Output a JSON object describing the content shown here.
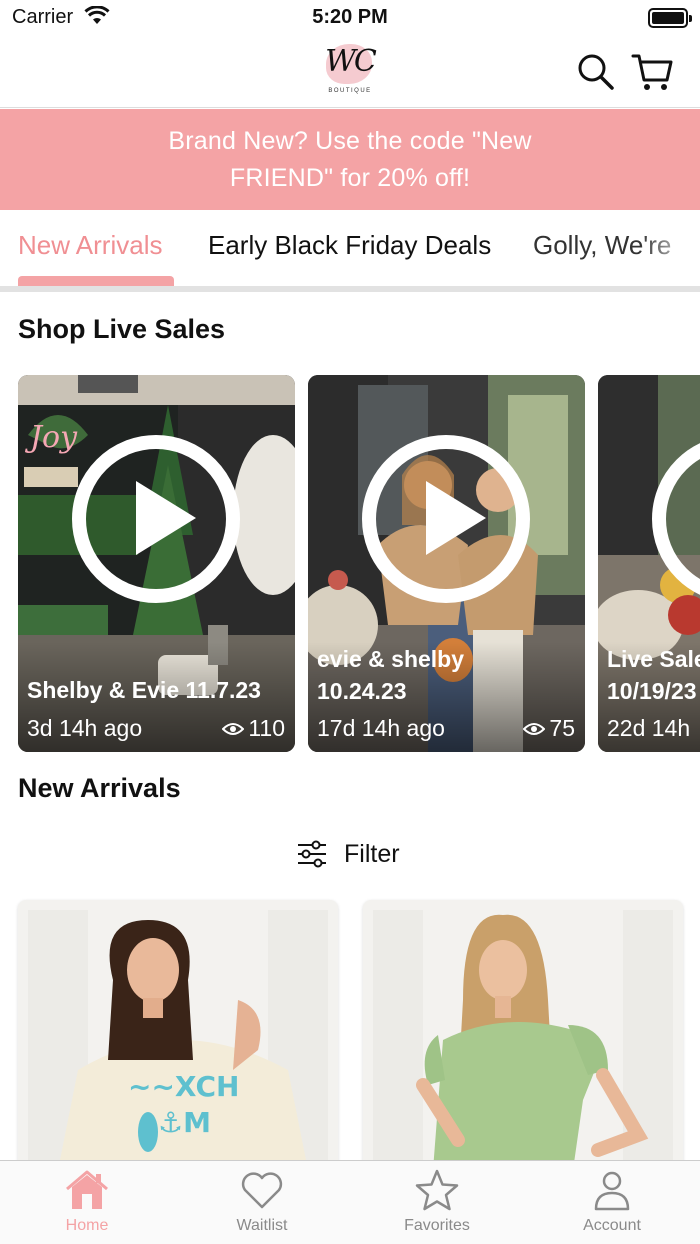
{
  "status_bar": {
    "carrier": "Carrier",
    "time": "5:20 PM"
  },
  "header": {
    "logo_mark": "WC",
    "logo_sub": "BOUTIQUE"
  },
  "promo": {
    "text": "Brand New? Use the code \"New FRIEND\" for 20% off!"
  },
  "category_tabs": [
    {
      "label": "New Arrivals",
      "active": true
    },
    {
      "label": "Early Black Friday Deals",
      "active": false
    },
    {
      "label": "Golly, We're",
      "active": false
    }
  ],
  "live_sales": {
    "title": "Shop Live Sales",
    "items": [
      {
        "title": "Shelby & Evie 11.7.23",
        "ago": "3d 14h ago",
        "views": "110"
      },
      {
        "title": "evie & shelby\n10.24.23",
        "ago": "17d 14h ago",
        "views": "75"
      },
      {
        "title": "Live Sale\n10/19/23",
        "ago": "22d 14h",
        "views": ""
      }
    ]
  },
  "new_arrivals": {
    "title": "New Arrivals",
    "filter_label": "Filter"
  },
  "tabbar": {
    "items": [
      {
        "label": "Home",
        "icon": "home-icon",
        "active": true
      },
      {
        "label": "Waitlist",
        "icon": "heart-icon",
        "active": false
      },
      {
        "label": "Favorites",
        "icon": "star-icon",
        "active": false
      },
      {
        "label": "Account",
        "icon": "person-icon",
        "active": false
      }
    ]
  },
  "colors": {
    "accent": "#f4a3a5",
    "accent_text": "#f08f93",
    "inactive": "#8a8a8a"
  }
}
